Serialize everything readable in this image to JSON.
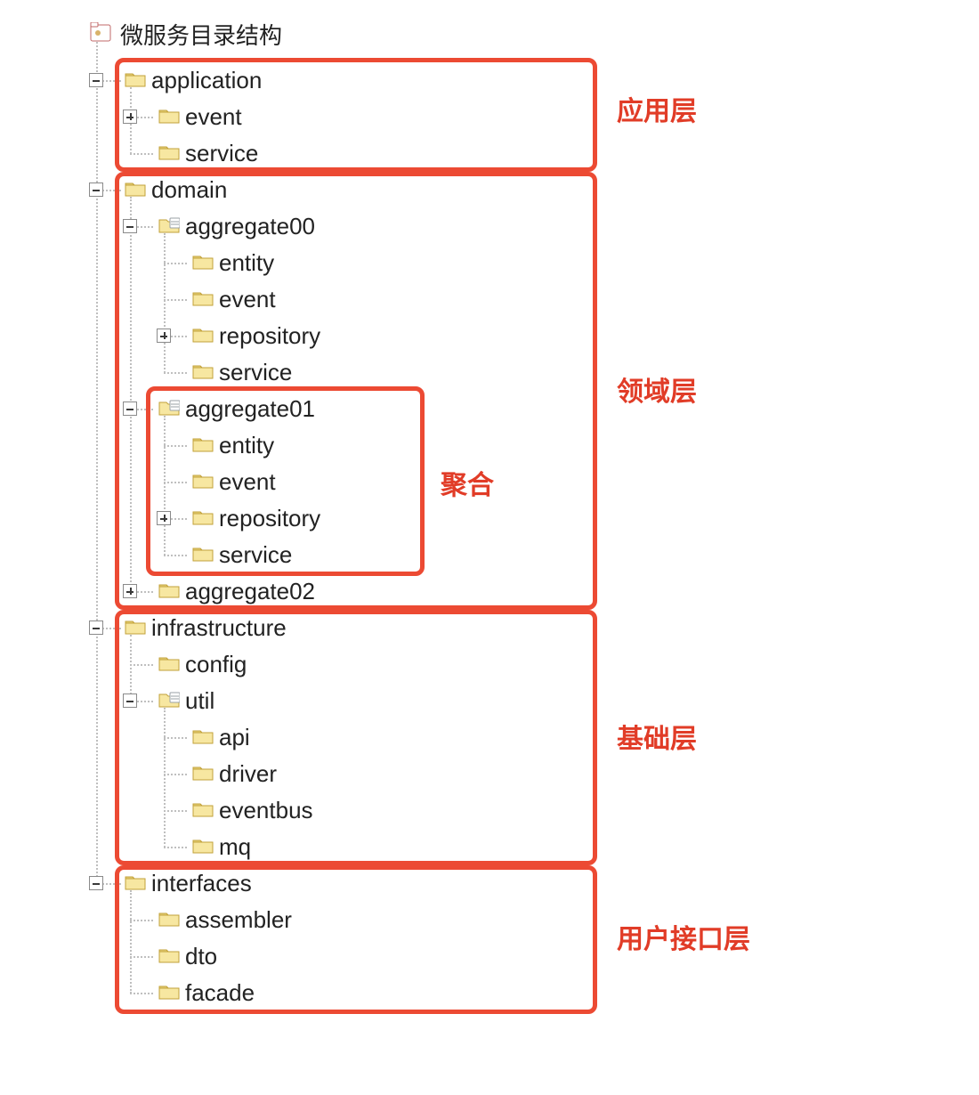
{
  "root": {
    "label": "微服务目录结构"
  },
  "application": {
    "label": "application",
    "children": {
      "event": "event",
      "service": "service"
    },
    "annotation": "应用层"
  },
  "domain": {
    "label": "domain",
    "annotation": "领域层",
    "agg00": {
      "label": "aggregate00",
      "children": {
        "entity": "entity",
        "event": "event",
        "repository": "repository",
        "service": "service"
      }
    },
    "agg01": {
      "label": "aggregate01",
      "annotation": "聚合",
      "children": {
        "entity": "entity",
        "event": "event",
        "repository": "repository",
        "service": "service"
      }
    },
    "agg02": {
      "label": "aggregate02"
    }
  },
  "infrastructure": {
    "label": "infrastructure",
    "annotation": "基础层",
    "children": {
      "config": "config",
      "util": {
        "label": "util",
        "children": {
          "api": "api",
          "driver": "driver",
          "eventbus": "eventbus",
          "mq": "mq"
        }
      }
    }
  },
  "interfaces": {
    "label": "interfaces",
    "annotation": "用户接口层",
    "children": {
      "assembler": "assembler",
      "dto": "dto",
      "facade": "facade"
    }
  }
}
